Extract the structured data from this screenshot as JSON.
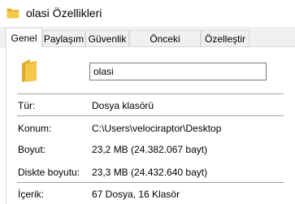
{
  "window": {
    "title": "olasi Özellikleri"
  },
  "tabs": [
    {
      "label": "Genel"
    },
    {
      "label": "Paylaşım"
    },
    {
      "label": "Güvenlik"
    },
    {
      "label": "Önceki Sürümler"
    },
    {
      "label": "Özelleştir"
    }
  ],
  "general": {
    "name_value": "olasi",
    "rows": [
      {
        "label": "Tür:",
        "value": "Dosya klasörü"
      },
      {
        "label": "Konum:",
        "value": "C:\\Users\\velociraptor\\Desktop"
      },
      {
        "label": "Boyut:",
        "value": "23,2 MB (24.382.067 bayt)"
      },
      {
        "label": "Diskte boyutu:",
        "value": "23,3 MB (24.432.640 bayt)"
      },
      {
        "label": "İçerik:",
        "value": "67 Dosya, 16 Klasör"
      }
    ]
  },
  "colors": {
    "folder": "#f4c84a",
    "folder_dark": "#dcaa2c",
    "divider": "#a0a0a0"
  },
  "icons": {
    "title": "folder-icon",
    "large": "folder-icon"
  }
}
